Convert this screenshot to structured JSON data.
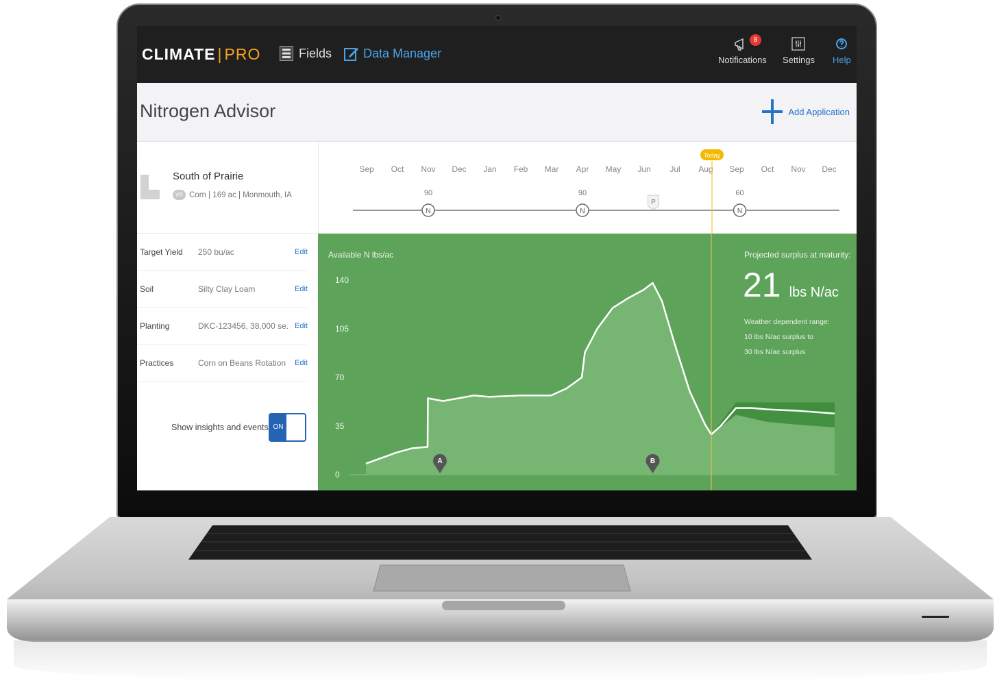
{
  "app": {
    "logo_main": "CLIMATE",
    "logo_sep": "|",
    "logo_accent": "PRO",
    "nav": {
      "fields": "Fields",
      "data_manager": "Data Manager"
    },
    "notifications": {
      "label": "Notifications",
      "count": "8"
    },
    "settings": {
      "label": "Settings"
    },
    "help": {
      "label": "Help"
    }
  },
  "page": {
    "title": "Nitrogen Advisor",
    "add_application": "Add Application"
  },
  "field": {
    "name": "South of Prairie",
    "badge": "VR",
    "details": "Corn | 169 ac | Monmouth, IA"
  },
  "properties": [
    {
      "label": "Target Yield",
      "value": "250 bu/ac",
      "edit": "Edit"
    },
    {
      "label": "Soil",
      "value": "Silty Clay Loam",
      "edit": "Edit"
    },
    {
      "label": "Planting",
      "value": "DKC-123456, 38,000 se...",
      "edit": "Edit"
    },
    {
      "label": "Practices",
      "value": "Corn on Beans Rotation",
      "edit": "Edit"
    }
  ],
  "toggle": {
    "label": "Show insights and events",
    "state": "ON"
  },
  "timeline": {
    "months": [
      "Sep",
      "Oct",
      "Nov",
      "Dec",
      "Jan",
      "Feb",
      "Mar",
      "Apr",
      "May",
      "Jun",
      "Jul",
      "Aug",
      "Sep",
      "Oct",
      "Nov",
      "Dec"
    ],
    "today_label": "Today",
    "today_month_index": 11.2,
    "events": [
      {
        "month_index": 2,
        "type": "N",
        "amount": "90"
      },
      {
        "month_index": 7,
        "type": "N",
        "amount": "90"
      },
      {
        "month_index": 9.3,
        "type": "P",
        "amount": ""
      },
      {
        "month_index": 12.1,
        "type": "N",
        "amount": "60"
      }
    ]
  },
  "projection": {
    "title": "Projected surplus at maturity:",
    "value": "21",
    "unit": "lbs N/ac",
    "range_title": "Weather dependent range:",
    "range_low": "10 lbs N/ac surplus to",
    "range_high": "30 lbs N/ac surplus"
  },
  "colors": {
    "chart_bg": "#5da35a",
    "accent_blue": "#2473c6",
    "logo_accent": "#f5a623",
    "today": "#f5b800"
  },
  "chart_data": {
    "type": "area",
    "ylabel": "Available N lbs/ac",
    "yticks": [
      0,
      35,
      70,
      105,
      140
    ],
    "ylim": [
      0,
      140
    ],
    "x_unit": "month_index",
    "xlim": [
      0,
      15.2
    ],
    "series": [
      {
        "points": [
          [
            0,
            8
          ],
          [
            0.5,
            12
          ],
          [
            1,
            16
          ],
          [
            1.5,
            19
          ],
          [
            2,
            20
          ],
          [
            2.01,
            55
          ],
          [
            2.5,
            53
          ],
          [
            3,
            55
          ],
          [
            3.5,
            57
          ],
          [
            4,
            56
          ],
          [
            5,
            57
          ],
          [
            6,
            57
          ],
          [
            6.5,
            62
          ],
          [
            7,
            70
          ],
          [
            7.1,
            88
          ],
          [
            7.5,
            105
          ],
          [
            8,
            120
          ],
          [
            8.5,
            127
          ],
          [
            9,
            133
          ],
          [
            9.3,
            138
          ],
          [
            9.6,
            125
          ],
          [
            10,
            95
          ],
          [
            10.5,
            60
          ],
          [
            11,
            36
          ],
          [
            11.2,
            29
          ],
          [
            11.5,
            35
          ],
          [
            12,
            48
          ],
          [
            12.5,
            48
          ],
          [
            13,
            47
          ],
          [
            14,
            46
          ],
          [
            15.2,
            44
          ]
        ]
      }
    ],
    "forecast_band": [
      [
        11.2,
        29,
        29
      ],
      [
        12,
        43,
        52
      ],
      [
        13,
        38,
        52
      ],
      [
        14,
        36,
        52
      ],
      [
        15.2,
        34,
        52
      ]
    ],
    "markers": [
      {
        "label": "A",
        "month_index": 2.4
      },
      {
        "label": "B",
        "month_index": 9.3
      }
    ]
  }
}
